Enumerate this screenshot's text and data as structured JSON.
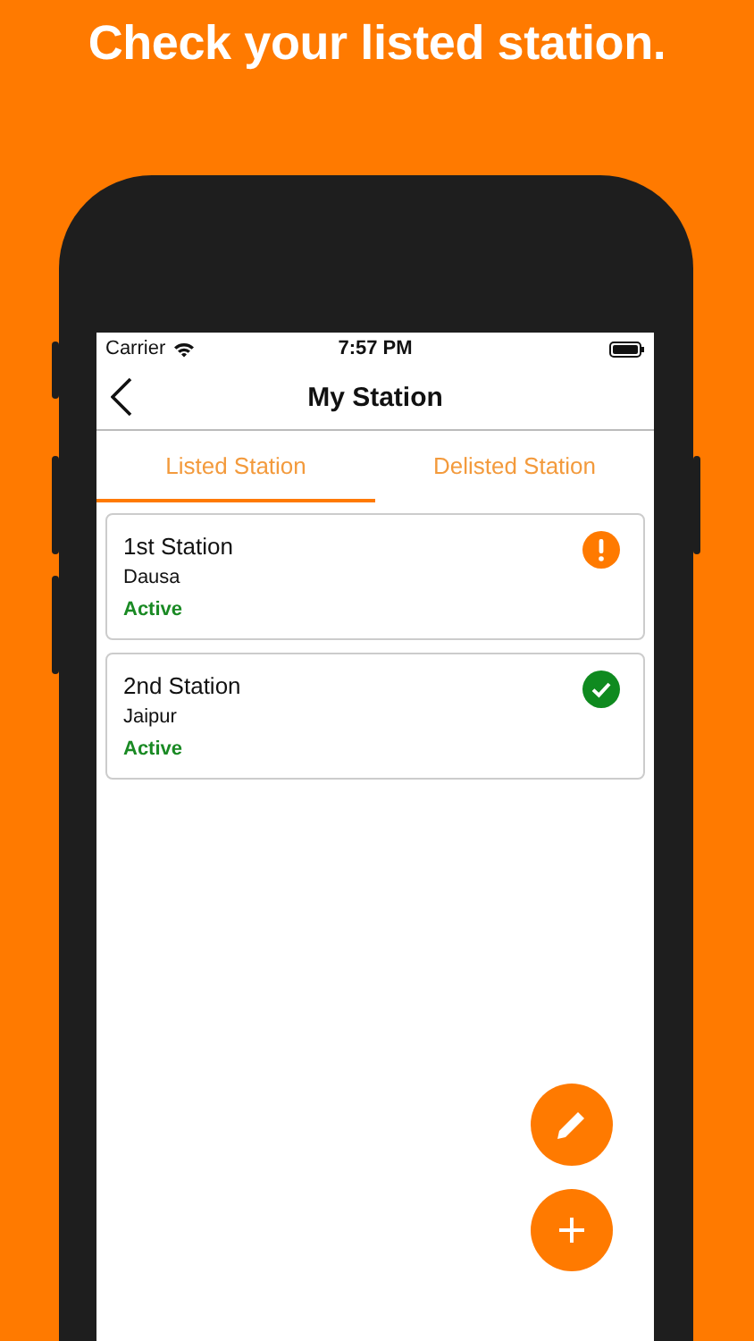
{
  "headline": "Check your listed station.",
  "status_bar": {
    "carrier": "Carrier",
    "time": "7:57 PM"
  },
  "nav": {
    "title": "My Station"
  },
  "tabs": [
    {
      "label": "Listed Station",
      "selected": true
    },
    {
      "label": "Delisted Station",
      "selected": false
    }
  ],
  "stations": [
    {
      "name": "1st Station",
      "city": "Dausa",
      "status": "Active",
      "kind": "warning"
    },
    {
      "name": "2nd Station",
      "city": "Jaipur",
      "status": "Active",
      "kind": "verified"
    }
  ],
  "fabs": [
    {
      "kind": "edit"
    },
    {
      "kind": "add"
    }
  ]
}
